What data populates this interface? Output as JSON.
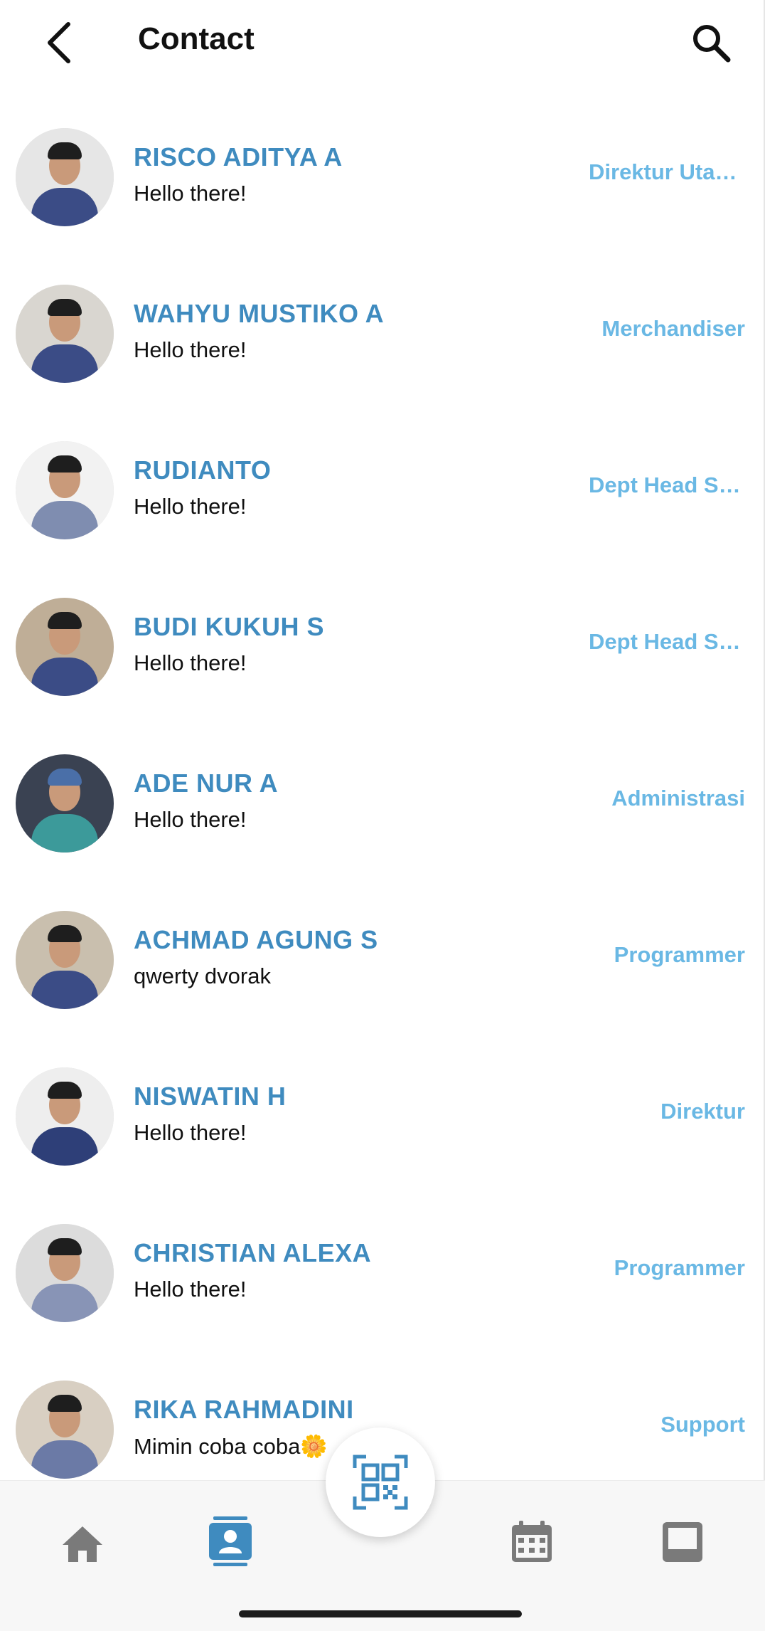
{
  "header": {
    "title": "Contact",
    "back_icon": "arrow-left-icon",
    "search_icon": "search-icon"
  },
  "contacts": [
    {
      "name": "RISCO ADITYA A",
      "message": "Hello there!",
      "role": "Direktur Utama"
    },
    {
      "name": "WAHYU MUSTIKO A",
      "message": "Hello there!",
      "role": "Merchandiser"
    },
    {
      "name": "RUDIANTO",
      "message": "Hello there!",
      "role": "Dept Head Sales"
    },
    {
      "name": "BUDI KUKUH S",
      "message": "Hello there!",
      "role": "Dept Head Sales"
    },
    {
      "name": "ADE NUR A",
      "message": "Hello there!",
      "role": "Administrasi"
    },
    {
      "name": "ACHMAD AGUNG S",
      "message": "qwerty dvorak",
      "role": "Programmer"
    },
    {
      "name": "NISWATIN H",
      "message": "Hello there!",
      "role": "Direktur"
    },
    {
      "name": "CHRISTIAN ALEXA",
      "message": "Hello there!",
      "role": "Programmer"
    },
    {
      "name": "RIKA RAHMADINI",
      "message": "Mimin coba coba🌼",
      "role": "Support"
    }
  ],
  "bottom_nav": {
    "items": [
      "home-icon",
      "contacts-icon",
      "qr-scan-icon",
      "calendar-icon",
      "inbox-icon"
    ],
    "active": "contacts-icon"
  },
  "colors": {
    "name": "#3f8bbf",
    "role": "#6ab8e4",
    "active_nav": "#3f8bbf",
    "inactive_nav": "#7a7a7a"
  }
}
